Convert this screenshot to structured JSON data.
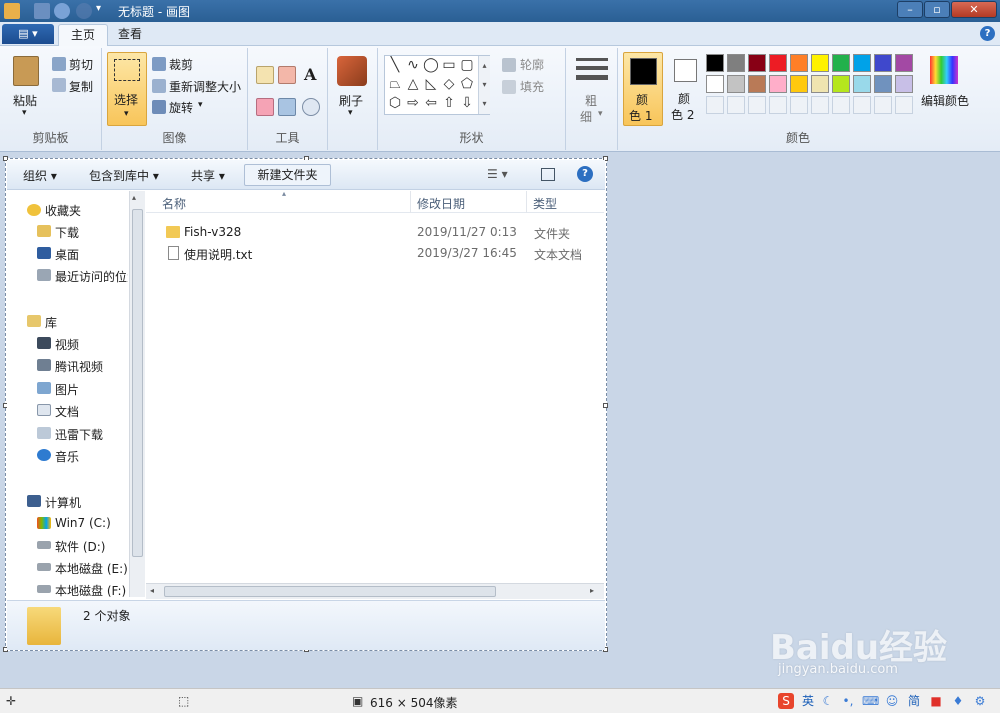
{
  "window": {
    "title": "无标题 - 画图"
  },
  "tabs": {
    "file": "▤ ▾",
    "home": "主页",
    "view": "查看"
  },
  "ribbon": {
    "clipboard": {
      "paste": "粘贴",
      "cut": "剪切",
      "copy": "复制",
      "label": "剪贴板"
    },
    "image": {
      "select": "选择",
      "crop": "裁剪",
      "resize": "重新调整大小",
      "rotate": "旋转",
      "label": "图像"
    },
    "tools": {
      "label": "工具"
    },
    "brushes": {
      "label": "刷子"
    },
    "shapes": {
      "outline": "轮廓",
      "fill": "填充",
      "label": "形状"
    },
    "size": {
      "label1": "粗",
      "label2": "细"
    },
    "colors": {
      "color1a": "颜",
      "color1b": "色 1",
      "color2a": "颜",
      "color2b": "色 2",
      "edit": "编辑颜色",
      "label": "颜色",
      "palette": [
        "#000000",
        "#7f7f7f",
        "#880015",
        "#ed1c24",
        "#ff7f27",
        "#fff200",
        "#22b14c",
        "#00a2e8",
        "#3f48cc",
        "#a349a4",
        "#ffffff",
        "#c3c3c3",
        "#b97a57",
        "#ffaec9",
        "#ffc90e",
        "#efe4b0",
        "#b5e61d",
        "#99d9ea",
        "#7092be",
        "#c8bfe7"
      ]
    }
  },
  "explorer": {
    "toolbar": {
      "organize": "组织 ▾",
      "include": "包含到库中 ▾",
      "share": "共享 ▾",
      "newfolder": "新建文件夹"
    },
    "nav": {
      "favorites": "收藏夹",
      "downloads": "下载",
      "desktop": "桌面",
      "recent": "最近访问的位置",
      "library": "库",
      "video": "视频",
      "tencent": "腾讯视频",
      "pictures": "图片",
      "docs": "文档",
      "xunlei": "迅雷下载",
      "music": "音乐",
      "computer": "计算机",
      "c": "Win7 (C:)",
      "d": "软件 (D:)",
      "e": "本地磁盘 (E:)",
      "f": "本地磁盘 (F:)"
    },
    "columns": {
      "name": "名称",
      "date": "修改日期",
      "type": "类型"
    },
    "rows": [
      {
        "name": "Fish-v328",
        "date": "2019/11/27 0:13",
        "type": "文件夹"
      },
      {
        "name": "使用说明.txt",
        "date": "2019/3/27 16:45",
        "type": "文本文档"
      }
    ],
    "details": "2 个对象"
  },
  "status": {
    "size": "616 × 504像素"
  },
  "ime": {
    "lang": "英",
    "simp": "简"
  },
  "watermark": {
    "text": "Baidu经验",
    "url": "jingyan.baidu.com"
  }
}
